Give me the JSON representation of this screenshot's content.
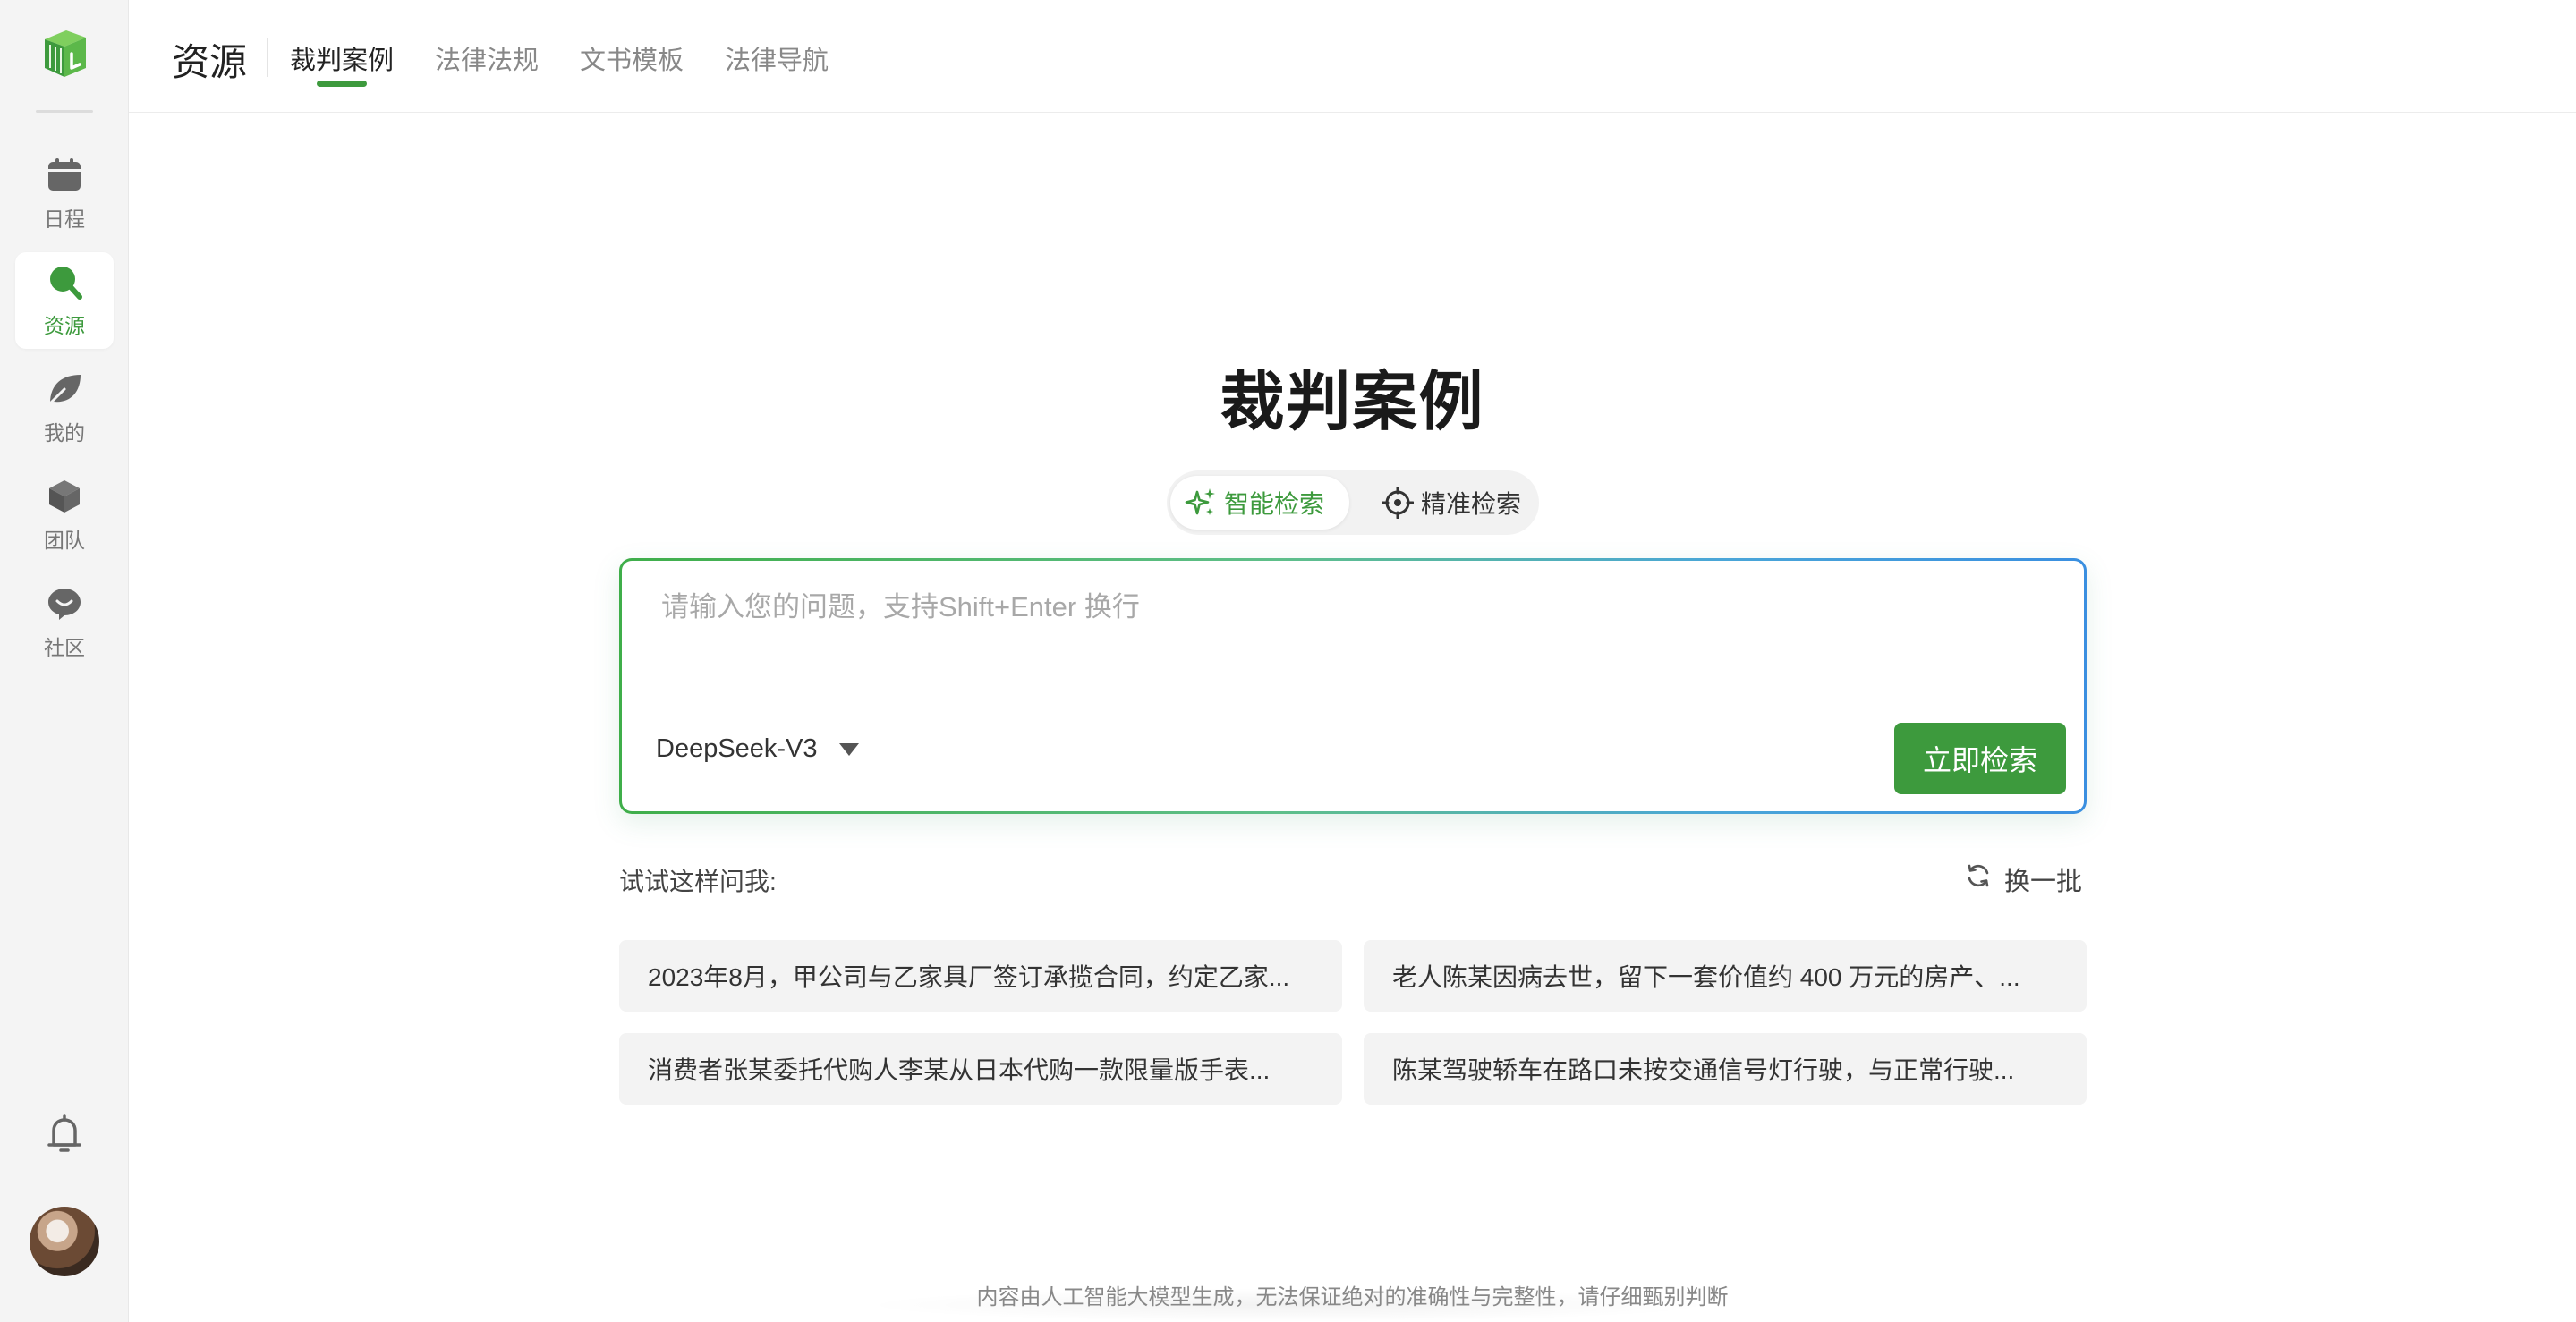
{
  "sidebar": {
    "items": [
      {
        "label": "日程",
        "icon": "calendar-icon"
      },
      {
        "label": "资源",
        "icon": "search-icon",
        "active": true
      },
      {
        "label": "我的",
        "icon": "leaf-icon"
      },
      {
        "label": "团队",
        "icon": "cube-icon"
      },
      {
        "label": "社区",
        "icon": "chat-bubble-icon"
      }
    ],
    "bottom": {
      "bell_icon": "bell-icon",
      "avatar_icon": "avatar"
    }
  },
  "header": {
    "title": "资源",
    "tabs": [
      {
        "label": "裁判案例",
        "active": true
      },
      {
        "label": "法律法规"
      },
      {
        "label": "文书模板"
      },
      {
        "label": "法律导航"
      }
    ]
  },
  "main": {
    "title": "裁判案例",
    "modes": {
      "smart": "智能检索",
      "precise": "精准检索",
      "active": "smart"
    },
    "search": {
      "placeholder": "请输入您的问题，支持Shift+Enter 换行",
      "value": "",
      "model": "DeepSeek-V3",
      "submit_label": "立即检索"
    },
    "try_label": "试试这样问我:",
    "refresh_label": "换一批",
    "suggestions": [
      "2023年8月，甲公司与乙家具厂签订承揽合同，约定乙家...",
      "老人陈某因病去世，留下一套价值约 400 万元的房产、...",
      "消费者张某委托代购人李某从日本代购一款限量版手表...",
      "陈某驾驶轿车在路口未按交通信号灯行驶，与正常行驶..."
    ]
  },
  "footer": {
    "disclaimer": "内容由人工智能大模型生成，无法保证绝对的准确性与完整性，请仔细甄别判断"
  },
  "colors": {
    "accent": "#3d9a3d",
    "gradient_start": "#3fae4a",
    "gradient_end": "#3a8fe0",
    "sidebar_bg": "#f4f4f4"
  }
}
